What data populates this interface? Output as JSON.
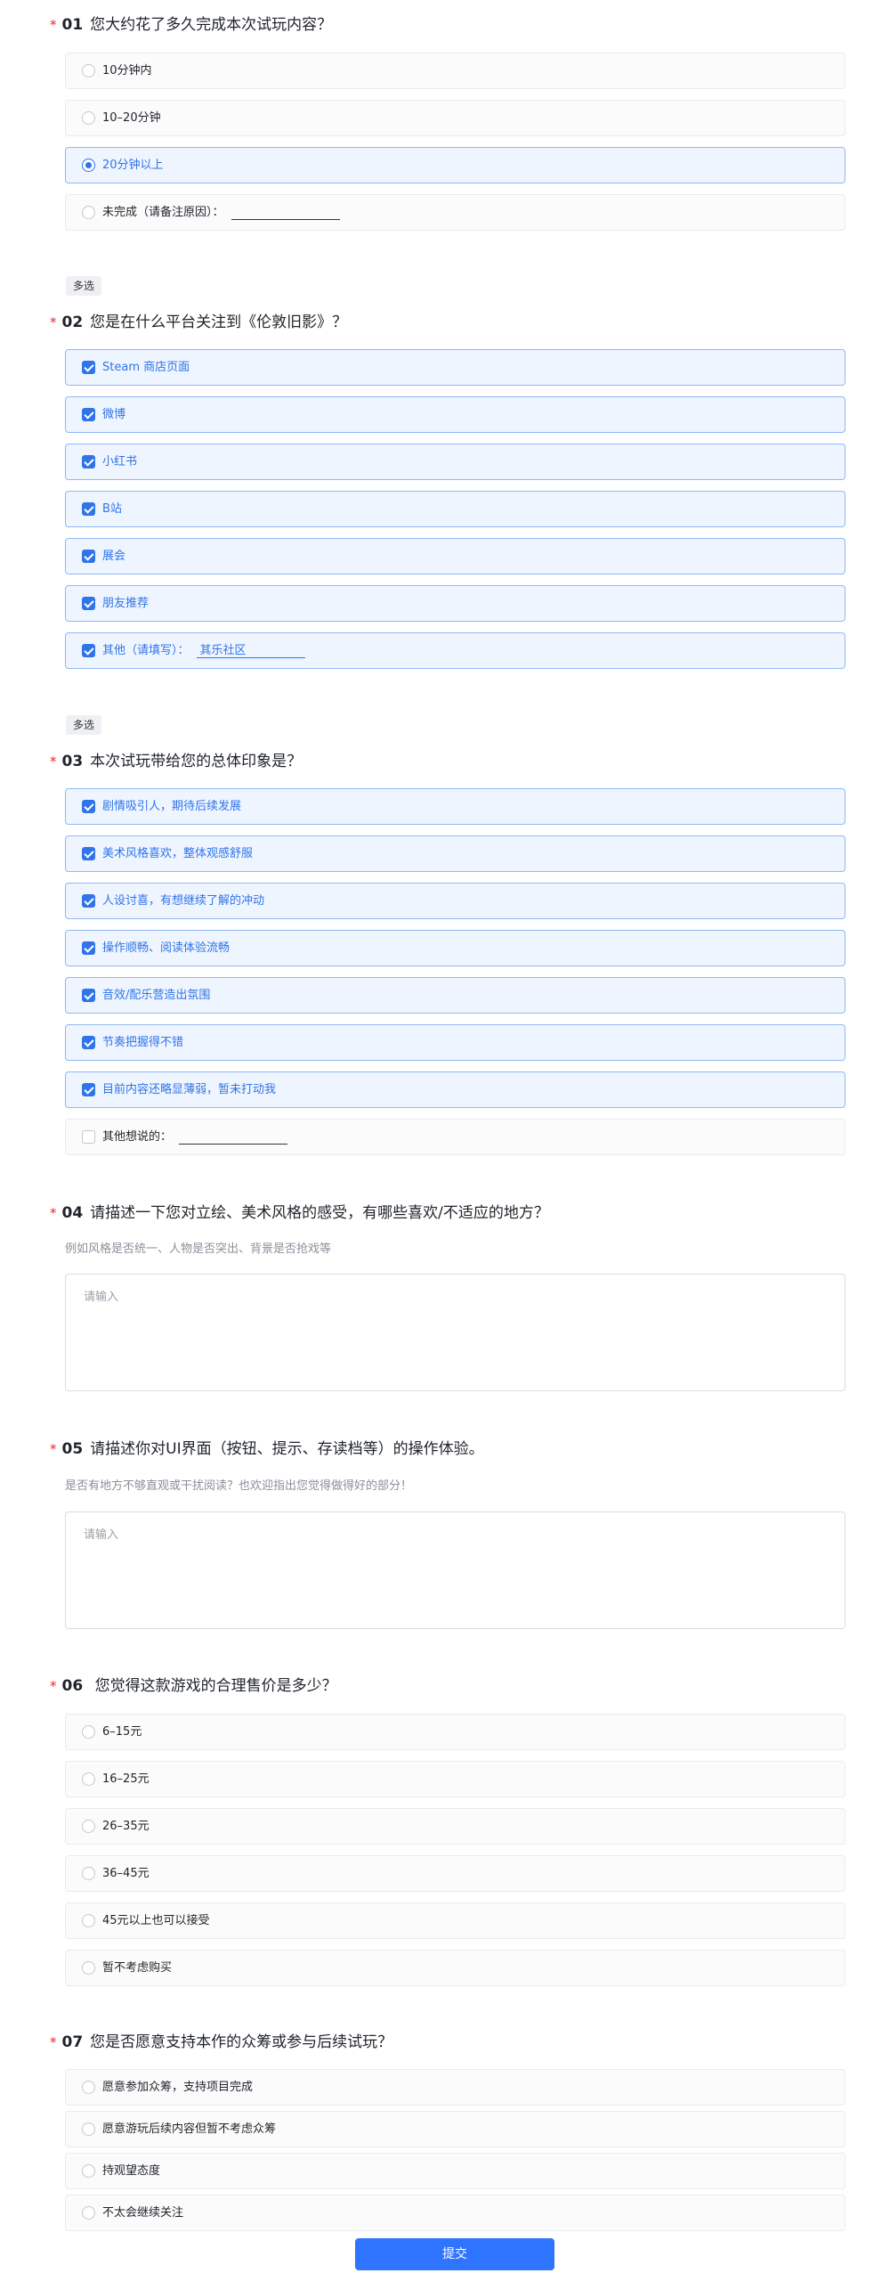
{
  "q1": {
    "num": "01",
    "title": "您大约花了多久完成本次试玩内容？",
    "options": [
      "10分钟内",
      "10–20分钟",
      "20分钟以上",
      "未完成（请备注原因）："
    ],
    "selected": 2
  },
  "q2": {
    "tag": "多选",
    "num": "02",
    "title": "您是在什么平台关注到《伦敦旧影》？",
    "options": [
      "Steam 商店页面",
      "微博",
      "小红书",
      "B站",
      "展会",
      "朋友推荐",
      "其他（请填写）："
    ],
    "other_value": "其乐社区"
  },
  "q3": {
    "tag": "多选",
    "num": "03",
    "title": "本次试玩带给您的总体印象是？",
    "options": [
      "剧情吸引人，期待后续发展",
      "美术风格喜欢，整体观感舒服",
      "人设讨喜，有想继续了解的冲动",
      "操作顺畅、阅读体验流畅",
      "音效/配乐营造出氛围",
      "节奏把握得不错",
      "目前内容还略显薄弱，暂未打动我",
      "其他想说的："
    ]
  },
  "q4": {
    "num": "04",
    "title": "请描述一下您对立绘、美术风格的感受，有哪些喜欢/不适应的地方？",
    "subtitle": "例如风格是否统一、人物是否突出、背景是否抢戏等",
    "placeholder": "请输入"
  },
  "q5": {
    "num": "05",
    "title": "请描述你对UI界面（按钮、提示、存读档等）的操作体验。",
    "subtitle": "是否有地方不够直观或干扰阅读？也欢迎指出您觉得做得好的部分！",
    "placeholder": "请输入"
  },
  "q6": {
    "num": "06",
    "title": " 您觉得这款游戏的合理售价是多少？",
    "options": [
      "6–15元",
      "16–25元",
      "26–35元",
      "36–45元",
      "45元以上也可以接受",
      "暂不考虑购买"
    ]
  },
  "q7": {
    "num": "07",
    "title": "您是否愿意支持本作的众筹或参与后续试玩？",
    "options": [
      "愿意参加众筹，支持项目完成",
      "愿意游玩后续内容但暂不考虑众筹",
      "持观望态度",
      "不太会继续关注"
    ]
  },
  "submit_label": "提交",
  "required_mark": "*",
  "colors": {
    "accent": "#2f74e8",
    "button": "#2f74ff",
    "required": "#f5222d"
  }
}
